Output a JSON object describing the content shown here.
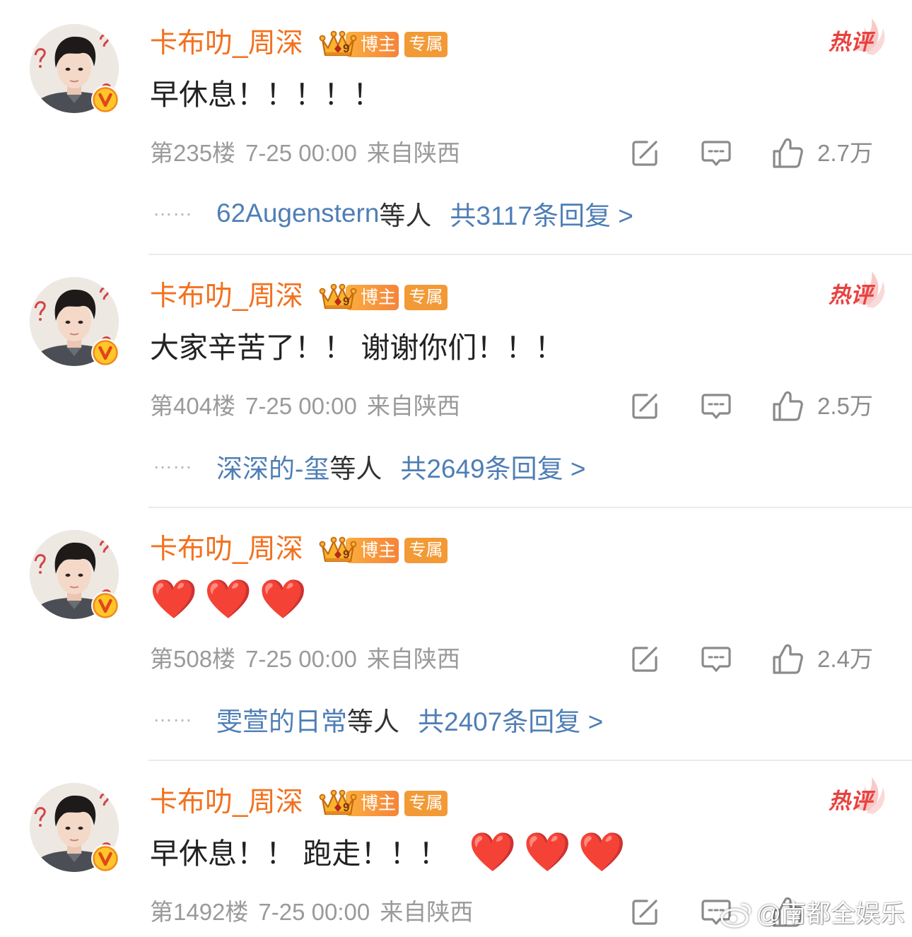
{
  "comments": [
    {
      "username": "卡布叻_周深",
      "badge_level": "9",
      "badge_label": "博主",
      "exclusive_label": "专属",
      "hot_label": "热评",
      "content_text": "早休息！！！！！",
      "floor": "第235楼",
      "time": "7-25 00:00",
      "location": "来自陕西",
      "like_count": "2.7万",
      "reply": {
        "ellipsis": "……",
        "users": "62Augenstern",
        "suffix": "等人",
        "total": "共3117条回复 >"
      }
    },
    {
      "username": "卡布叻_周深",
      "badge_level": "9",
      "badge_label": "博主",
      "exclusive_label": "专属",
      "hot_label": "热评",
      "content_text": "大家辛苦了！！ 谢谢你们！！！",
      "floor": "第404楼",
      "time": "7-25 00:00",
      "location": "来自陕西",
      "like_count": "2.5万",
      "reply": {
        "ellipsis": "……",
        "users": "深深的-玺",
        "suffix": "等人",
        "total": "共2649条回复 >"
      }
    },
    {
      "username": "卡布叻_周深",
      "badge_level": "9",
      "badge_label": "博主",
      "exclusive_label": "专属",
      "content_emoji": "❤️❤️❤️",
      "floor": "第508楼",
      "time": "7-25 00:00",
      "location": "来自陕西",
      "like_count": "2.4万",
      "reply": {
        "ellipsis": "……",
        "users": "雯萱的日常",
        "suffix": "等人",
        "total": "共2407条回复 >"
      }
    },
    {
      "username": "卡布叻_周深",
      "badge_level": "9",
      "badge_label": "博主",
      "exclusive_label": "专属",
      "hot_label": "热评",
      "content_text": "早休息！！ 跑走！！！",
      "content_emoji": "❤️❤️❤️",
      "floor": "第1492楼",
      "time": "7-25 00:00",
      "location": "来自陕西"
    }
  ],
  "watermark": {
    "icon": "weibo-logo-icon",
    "text": "@南都全娱乐"
  },
  "icons": {
    "verified": "verified-v-icon",
    "crown": "crown-icon",
    "hot": "hot-comment-icon",
    "repost": "repost-edit-icon",
    "comment": "comment-bubble-icon",
    "like": "thumbs-up-icon"
  },
  "colors": {
    "username": "#F2711F",
    "link": "#4F7EB5",
    "hot": "#E8423F",
    "meta": "#9A9A9A",
    "badge_orange": "#F5953A",
    "heart": "#E3201B"
  }
}
